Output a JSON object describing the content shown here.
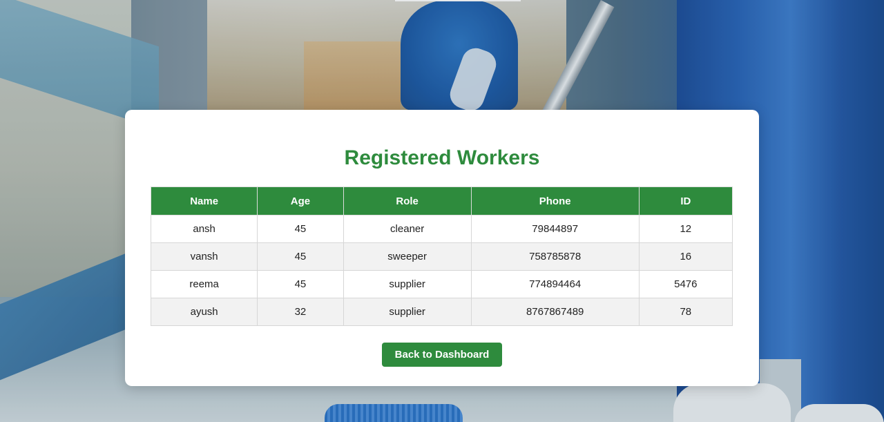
{
  "page": {
    "title": "Registered Workers"
  },
  "table": {
    "headers": [
      "Name",
      "Age",
      "Role",
      "Phone",
      "ID"
    ],
    "rows": [
      [
        "ansh",
        "45",
        "cleaner",
        "79844897",
        "12"
      ],
      [
        "vansh",
        "45",
        "sweeper",
        "758785878",
        "16"
      ],
      [
        "reema",
        "45",
        "supplier",
        "774894464",
        "5476"
      ],
      [
        "ayush",
        "32",
        "supplier",
        "8767867489",
        "78"
      ]
    ]
  },
  "actions": {
    "back_label": "Back to Dashboard"
  },
  "colors": {
    "accent": "#2e8b3d",
    "row_alt": "#f2f2f2",
    "card": "#ffffff"
  }
}
